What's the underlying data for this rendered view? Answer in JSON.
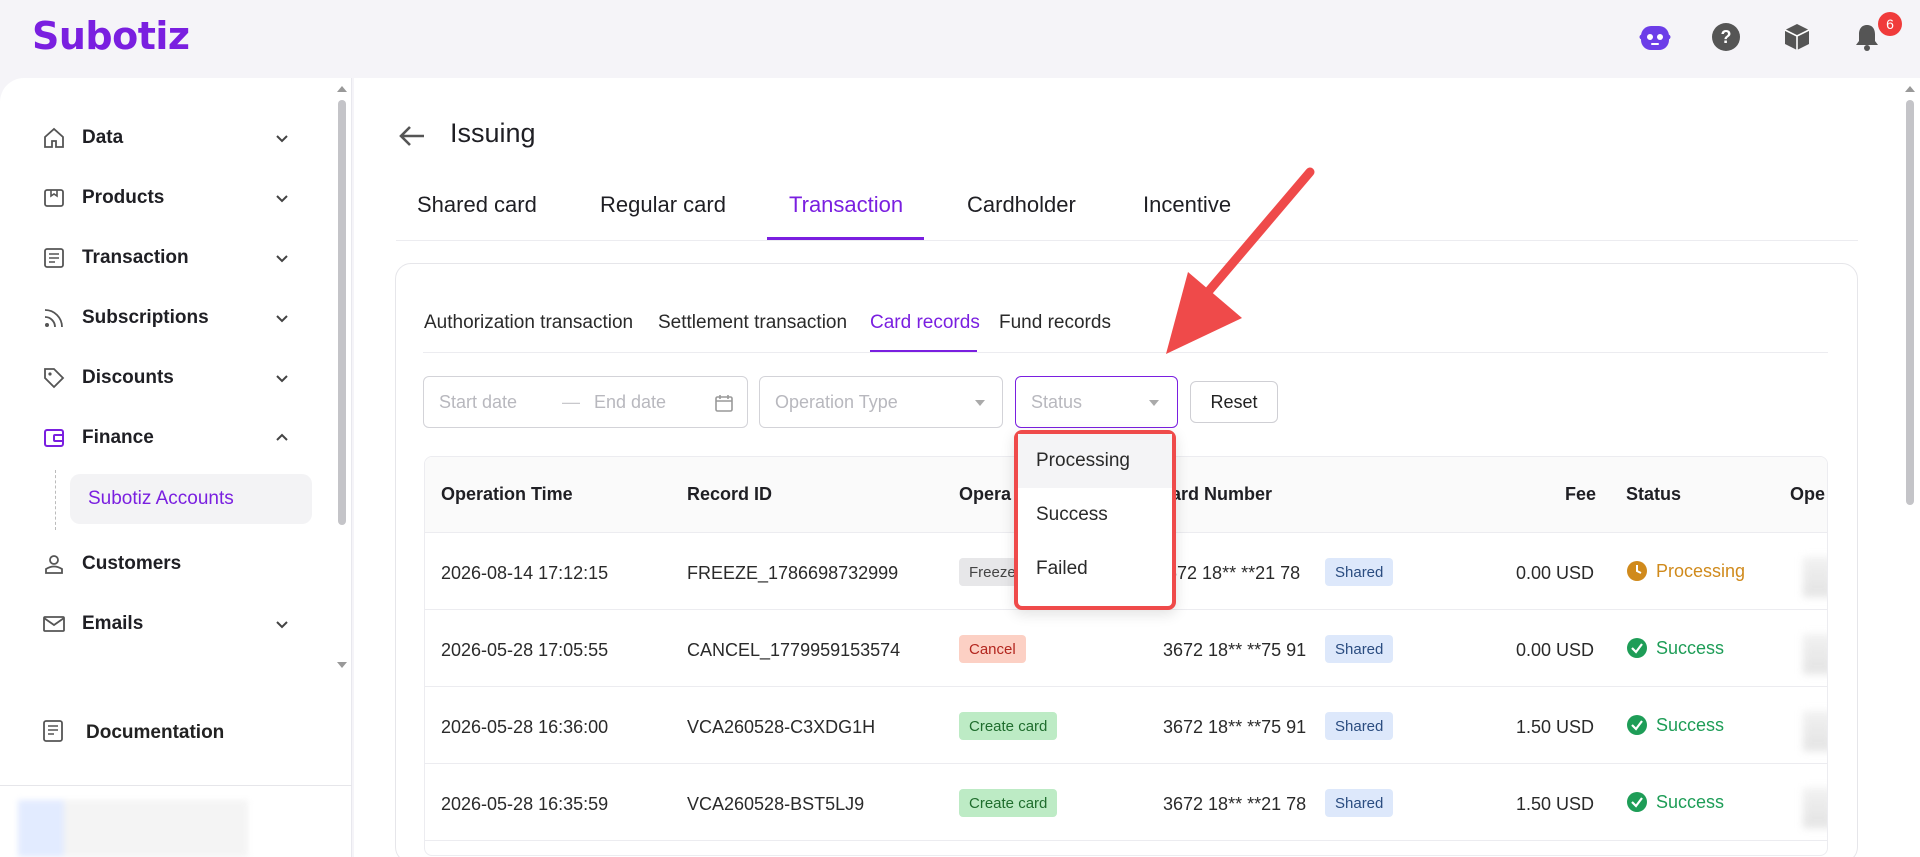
{
  "brand": {
    "logo": "Subotiz",
    "accent": "#7a1fe0"
  },
  "topbar": {
    "notification_count": "6"
  },
  "sidebar": {
    "items": [
      {
        "label": "Data"
      },
      {
        "label": "Products"
      },
      {
        "label": "Transaction"
      },
      {
        "label": "Subscriptions"
      },
      {
        "label": "Discounts"
      },
      {
        "label": "Finance"
      },
      {
        "label": "Customers"
      },
      {
        "label": "Emails"
      }
    ],
    "sub_item": "Subotiz Accounts",
    "documentation": "Documentation"
  },
  "page": {
    "title": "Issuing",
    "tabs": [
      "Shared card",
      "Regular card",
      "Transaction",
      "Cardholder",
      "Incentive"
    ],
    "sub_tabs": [
      "Authorization transaction",
      "Settlement transaction",
      "Card records",
      "Fund records"
    ]
  },
  "filters": {
    "start_placeholder": "Start date",
    "separator": "—",
    "end_placeholder": "End date",
    "operation_placeholder": "Operation Type",
    "status_placeholder": "Status",
    "reset": "Reset"
  },
  "dropdown": {
    "options": [
      "Processing",
      "Success",
      "Failed"
    ]
  },
  "table": {
    "columns": [
      "Operation Time",
      "Record ID",
      "Opera",
      "ard Number",
      "Fee",
      "Status",
      "Ope"
    ],
    "rows": [
      {
        "time": "2026-08-14 17:12:15",
        "record_id": "FREEZE_1786698732999",
        "operation": "Freeze",
        "card": "3672 18** **21 78",
        "card_type": "Shared",
        "fee": "0.00 USD",
        "status": "Processing"
      },
      {
        "time": "2026-05-28 17:05:55",
        "record_id": "CANCEL_1779959153574",
        "operation": "Cancel",
        "card": "3672 18** **75 91",
        "card_type": "Shared",
        "fee": "0.00 USD",
        "status": "Success"
      },
      {
        "time": "2026-05-28 16:36:00",
        "record_id": "VCA260528-C3XDG1H",
        "operation": "Create card",
        "card": "3672 18** **75 91",
        "card_type": "Shared",
        "fee": "1.50 USD",
        "status": "Success"
      },
      {
        "time": "2026-05-28 16:35:59",
        "record_id": "VCA260528-BST5LJ9",
        "operation": "Create card",
        "card": "3672 18** **21 78",
        "card_type": "Shared",
        "fee": "1.50 USD",
        "status": "Success"
      }
    ]
  },
  "colors": {
    "processing": "#d08a1c",
    "success": "#1e9d57",
    "annotation": "#ef4a4a"
  }
}
